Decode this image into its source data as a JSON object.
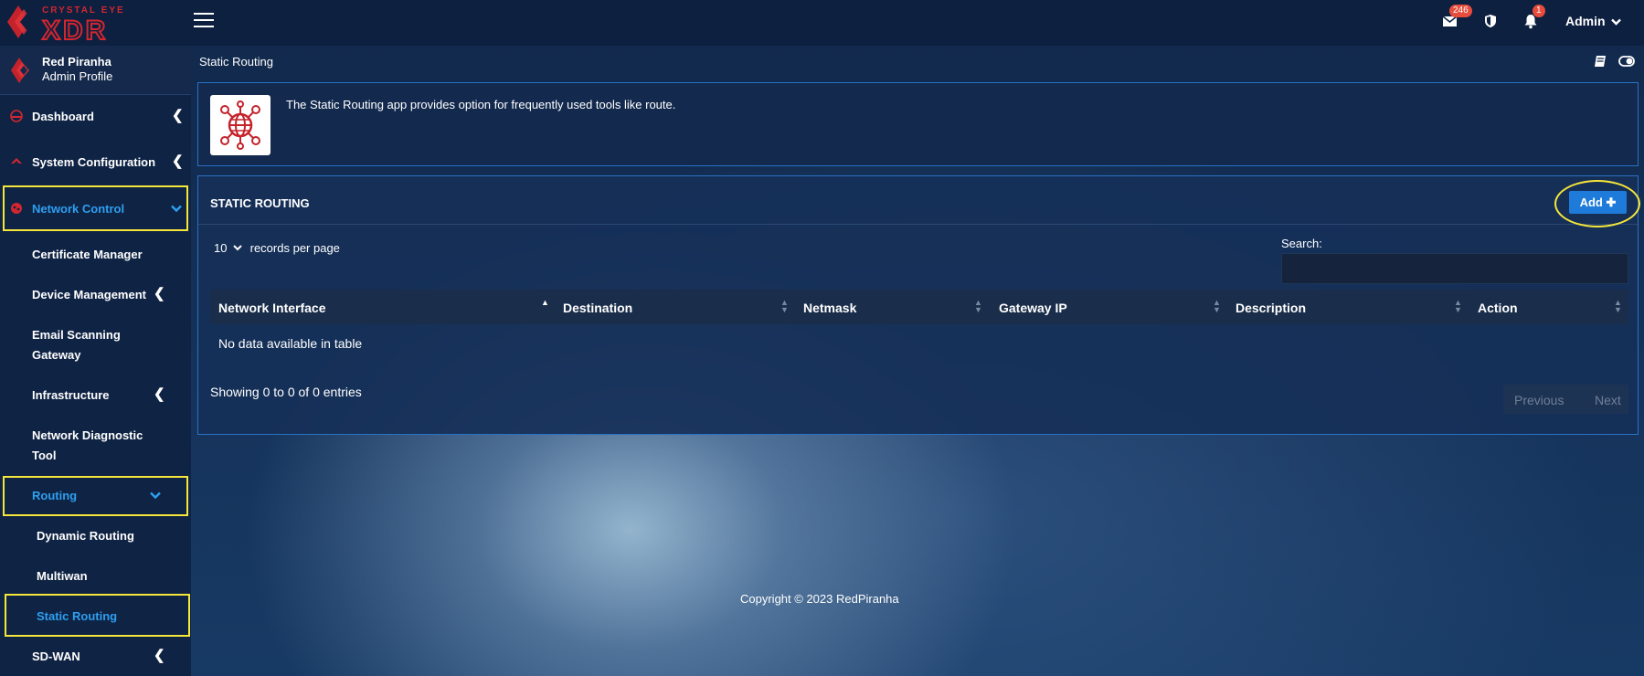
{
  "brand": {
    "top_text": "CRYSTAL EYE",
    "logo_text": "XDR"
  },
  "header": {
    "mail_count": "246",
    "alert_count": "1",
    "admin_label": "Admin"
  },
  "profile": {
    "name": "Red Piranha",
    "role": "Admin Profile"
  },
  "sidebar": {
    "items": [
      {
        "label": "Dashboard"
      },
      {
        "label": "System Configuration"
      },
      {
        "label": "Network Control"
      },
      {
        "label": "Certificate Manager"
      },
      {
        "label": "Device Management"
      },
      {
        "label": "Email Scanning"
      },
      {
        "label": "Gateway"
      },
      {
        "label": "Infrastructure"
      },
      {
        "label": "Network Diagnostic"
      },
      {
        "label": "Tool"
      },
      {
        "label": "Routing"
      },
      {
        "label": "Dynamic Routing"
      },
      {
        "label": "Multiwan"
      },
      {
        "label": "Static Routing"
      },
      {
        "label": "SD-WAN"
      }
    ]
  },
  "breadcrumb": "Static Routing",
  "info": {
    "text": "The Static Routing app provides option for frequently used tools like route."
  },
  "table_card": {
    "title": "STATIC ROUTING",
    "add_label": "Add",
    "page_size": "10",
    "records_label": "records per page",
    "search_label": "Search:",
    "search_value": "",
    "columns": [
      "Network Interface",
      "Destination",
      "Netmask",
      "Gateway IP",
      "Description",
      "Action"
    ],
    "empty_text": "No data available in table",
    "showing_text": "Showing 0 to 0 of 0 entries",
    "prev_label": "Previous",
    "next_label": "Next"
  },
  "footer": "Copyright © 2023 RedPiranha",
  "colors": {
    "accent": "#1f7bd9",
    "active_nav": "#2e9ff0",
    "highlight": "#f5e63a",
    "badge": "#e74c3c",
    "brand_red": "#d3262f"
  }
}
